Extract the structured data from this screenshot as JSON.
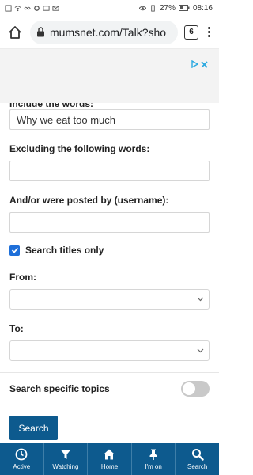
{
  "status_bar": {
    "battery": "27%",
    "time": "08:16"
  },
  "browser": {
    "url": "mumsnet.com/Talk?sho",
    "tab_count": "6"
  },
  "form": {
    "include_words_label": "Include the words:",
    "include_words_value": "Why we eat too much",
    "exclude_label": "Excluding the following words:",
    "exclude_value": "",
    "username_label": "And/or were posted by (username):",
    "username_value": "",
    "titles_only_label": "Search titles only",
    "titles_only_checked": true,
    "from_label": "From:",
    "from_value": "",
    "to_label": "To:",
    "to_value": "",
    "topics_label": "Search specific topics",
    "topics_enabled": false,
    "search_button": "Search"
  },
  "bottom_nav": {
    "items": [
      {
        "label": "Active",
        "icon": "clock-icon"
      },
      {
        "label": "Watching",
        "icon": "filter-icon"
      },
      {
        "label": "Home",
        "icon": "home-icon"
      },
      {
        "label": "I'm on",
        "icon": "pin-icon"
      },
      {
        "label": "Search",
        "icon": "search-icon"
      }
    ]
  },
  "colors": {
    "brand": "#0d5a8e",
    "checkbox": "#1e6fd9",
    "toggle_off": "#c9c9c9"
  }
}
